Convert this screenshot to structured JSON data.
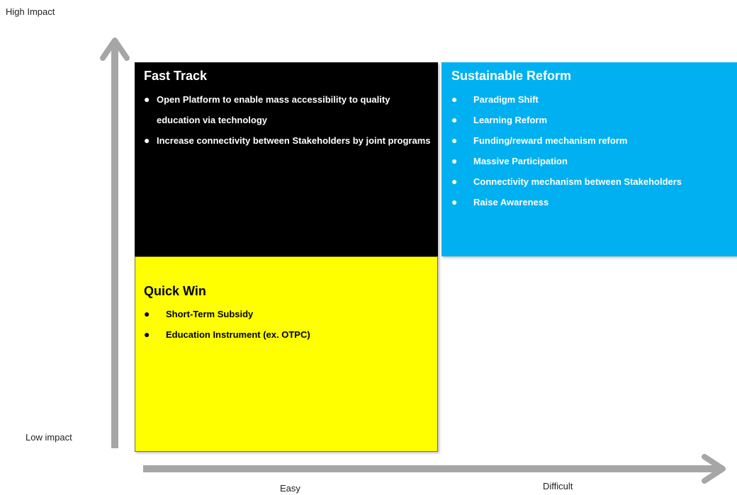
{
  "axis": {
    "high_impact": "High Impact",
    "low_impact": "Low impact",
    "easy": "Easy",
    "difficult": "Difficult",
    "arrow_color": "#a6a6a6"
  },
  "quadrants": {
    "fast_track": {
      "title": "Fast Track",
      "color": "#000000",
      "items": [
        "Open Platform to enable mass accessibility to quality education via technology",
        "Increase connectivity between Stakeholders by joint programs"
      ]
    },
    "sustainable_reform": {
      "title": "Sustainable Reform",
      "color": "#00b0f0",
      "items": [
        "Paradigm Shift",
        "Learning Reform",
        "Funding/reward mechanism reform",
        "Massive Participation",
        "Connectivity mechanism between Stakeholders",
        "Raise Awareness"
      ]
    },
    "quick_win": {
      "title": "Quick Win",
      "color": "#ffff00",
      "items": [
        "Short-Term Subsidy",
        "Education Instrument (ex. OTPC)"
      ]
    }
  }
}
